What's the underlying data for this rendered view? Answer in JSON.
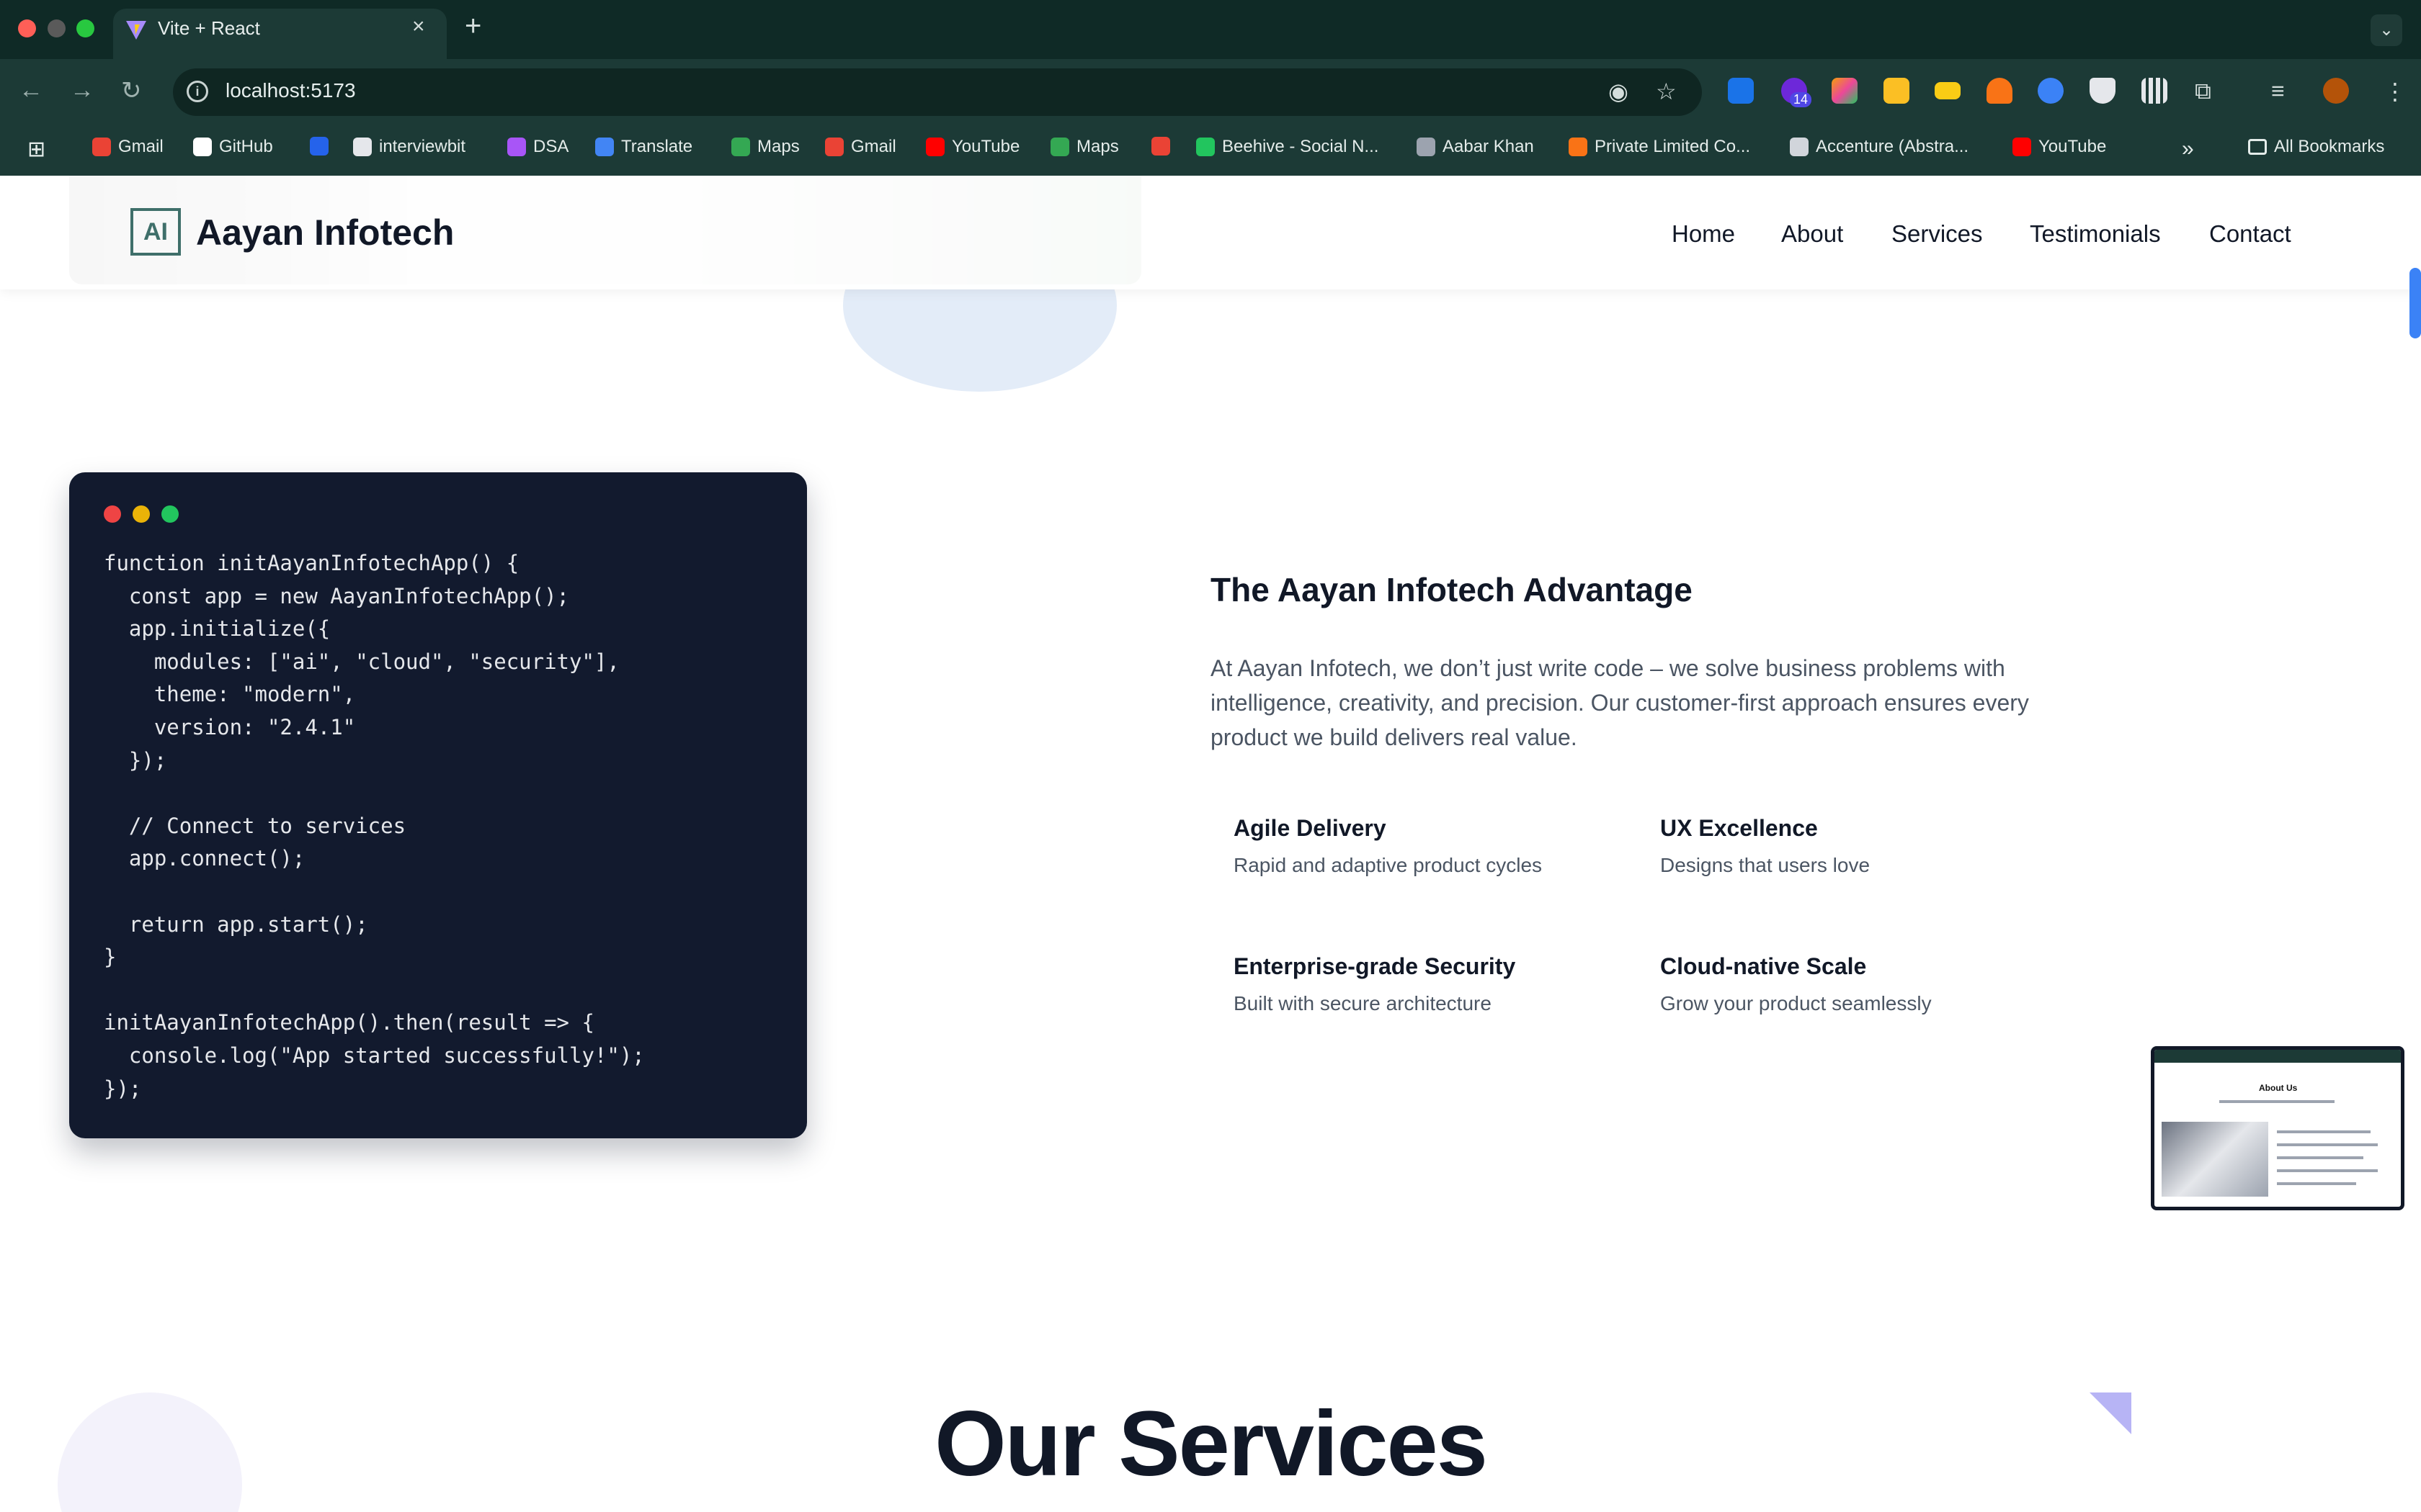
{
  "browser": {
    "tab_title": "Vite + React",
    "url": "localhost:5173",
    "extension_badge": "14",
    "bookmarks": [
      {
        "label": "Gmail",
        "color": "#ea4335"
      },
      {
        "label": "GitHub",
        "color": "#ffffff"
      },
      {
        "label": "",
        "color": "#2563eb"
      },
      {
        "label": "interviewbit",
        "color": "#e5e7eb"
      },
      {
        "label": "DSA",
        "color": "#a855f7"
      },
      {
        "label": "Translate",
        "color": "#4285f4"
      },
      {
        "label": "Maps",
        "color": "#34a853"
      },
      {
        "label": "Gmail",
        "color": "#ea4335"
      },
      {
        "label": "YouTube",
        "color": "#ff0000"
      },
      {
        "label": "Maps",
        "color": "#34a853"
      },
      {
        "label": "",
        "color": "#ea4335"
      },
      {
        "label": "Beehive - Social N...",
        "color": "#22c55e"
      },
      {
        "label": "Aabar Khan",
        "color": "#9ca3af"
      },
      {
        "label": "Private Limited Co...",
        "color": "#f97316"
      },
      {
        "label": "Accenture (Abstra...",
        "color": "#d1d5db"
      },
      {
        "label": "YouTube",
        "color": "#ff0000"
      }
    ],
    "all_bookmarks": "All Bookmarks"
  },
  "navbar": {
    "logo_text": "AI",
    "brand": "Aayan Infotech",
    "links": [
      "Home",
      "About",
      "Services",
      "Testimonials",
      "Contact"
    ]
  },
  "code_card": {
    "lines": [
      "function initAayanInfotechApp() {",
      "  const app = new AayanInfotechApp();",
      "  app.initialize({",
      "    modules: [\"ai\", \"cloud\", \"security\"],",
      "    theme: \"modern\",",
      "    version: \"2.4.1\"",
      "  });",
      "",
      "  // Connect to services",
      "  app.connect();",
      "",
      "  return app.start();",
      "}",
      "",
      "initAayanInfotechApp().then(result => {",
      "  console.log(\"App started successfully!\");",
      "});"
    ]
  },
  "advantage": {
    "title": "The Aayan Infotech Advantage",
    "description": "At Aayan Infotech, we don’t just write code – we solve business problems with intelligence, creativity, and precision. Our customer-first approach ensures every product we build delivers real value.",
    "features": [
      {
        "title": "Agile Delivery",
        "desc": "Rapid and adaptive product cycles"
      },
      {
        "title": "UX Excellence",
        "desc": "Designs that users love"
      },
      {
        "title": "Enterprise-grade Security",
        "desc": "Built with secure architecture"
      },
      {
        "title": "Cloud-native Scale",
        "desc": "Grow your product seamlessly"
      }
    ]
  },
  "preview_thumbnail": {
    "title": "About Us"
  },
  "services": {
    "title": "Our Services"
  },
  "colors": {
    "chrome_bg": "#0f2a26",
    "toolbar_bg": "#1c3a36",
    "code_bg": "#121a2e",
    "brand_teal": "#3f6f6a",
    "scroll_accent": "#3b82f6"
  }
}
